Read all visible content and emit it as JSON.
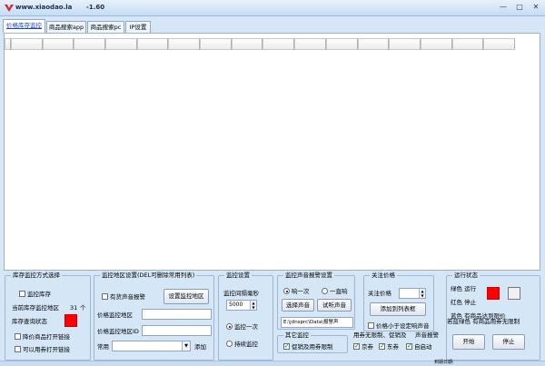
{
  "window": {
    "title": "www.xiaodao.la",
    "version": "-1.60",
    "buttons": {
      "minimize": "—",
      "maximize": "□",
      "close": "✕"
    }
  },
  "tabs": [
    {
      "label": "价格库存监控"
    },
    {
      "label": "商品搜索app"
    },
    {
      "label": "商品搜索pc"
    },
    {
      "label": "IP设置"
    }
  ],
  "panel_mode": {
    "title": "库存监控方式选择",
    "monitor_stock": "监控库存",
    "region_label": "当前库存监控地区",
    "region_count": "31",
    "region_unit": "个",
    "status_label": "库存查询状态",
    "status_color": "#ff0000",
    "open_on_price_drop": "降价商品打开链接",
    "open_on_coupon": "可以用券打开链接"
  },
  "panel_region": {
    "title": "监控地区设置(DEL可删除常用列表)",
    "has_stock_alarm": "有货声音报警",
    "set_region_button": "设置监控地区",
    "price_region_label": "价格监控地区",
    "price_region_value": "",
    "price_region_id_label": "价格监控地区ID",
    "price_region_id_value": "",
    "common_label": "常用",
    "common_value": "",
    "add_button": "添加"
  },
  "panel_monitor": {
    "title": "监控设置",
    "interval_label": "监控间隔毫秒",
    "interval_value": "5000",
    "once": "监控一次",
    "continuous": "持续监控"
  },
  "panel_sound": {
    "title": "监控声音报警设置",
    "ring_once": "响一次",
    "ring_always": "一直响",
    "choose_sound_button": "选择声音",
    "test_sound_button": "试听声音",
    "sound_path": "E:\\jdnsprc\\Data\\报警声"
  },
  "panel_other": {
    "title": "其它监控",
    "promo_limit": "促销及用券限制"
  },
  "panel_coupon": {
    "title": "用券无限制、促销及",
    "title_tail": "声音报警",
    "jingquan": "京券",
    "dongquan": "东券",
    "auto_start": "自启动"
  },
  "panel_watch": {
    "title": "关注价格",
    "watch_price_label": "关注价格",
    "watch_price_value": "",
    "add_to_list_button": "添加到列表框",
    "below_price_alarm": "价格小于设定响声音"
  },
  "panel_status": {
    "title": "运行状态",
    "green_label": "绿色  运行",
    "red_label": "红色  停止",
    "blue_label": "蓝色  有商品达到限价",
    "green_blue_label": "若蓝绿色  有商品用券无限制",
    "indicator_color": "#ff0000",
    "indicator_idle_color": "#f0f0f0",
    "start_button": "开始",
    "stop_button": "停止"
  },
  "status_bar": {
    "expiry": "到期日期:"
  }
}
